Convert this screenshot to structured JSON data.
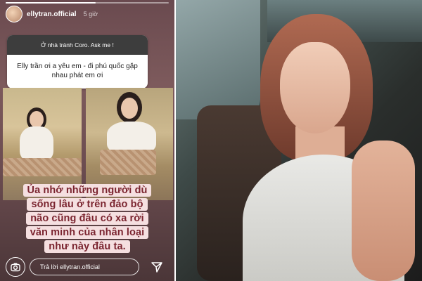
{
  "story": {
    "progress_fraction": 0.55,
    "username": "ellytran.official",
    "time_ago": "5 giờ",
    "question_prompt": "Ở nhà tránh Coro. Ask me !",
    "question_answer": "Elly trần ơi a yêu em - đi phú quốc gặp nhau phát em ơi",
    "caption_lines": [
      "Ủa nhớ những người dù",
      "sống lâu ở trên đảo bộ",
      "não cũng đâu có xa rời",
      "văn minh của nhân loại",
      "như này đâu ta."
    ],
    "reply_placeholder": "Trả lời ellytran.official",
    "icons": {
      "camera": "camera-icon",
      "send": "send-icon"
    },
    "colors": {
      "caption_bg": "#f5dfe0",
      "caption_text": "#7b2530"
    }
  }
}
